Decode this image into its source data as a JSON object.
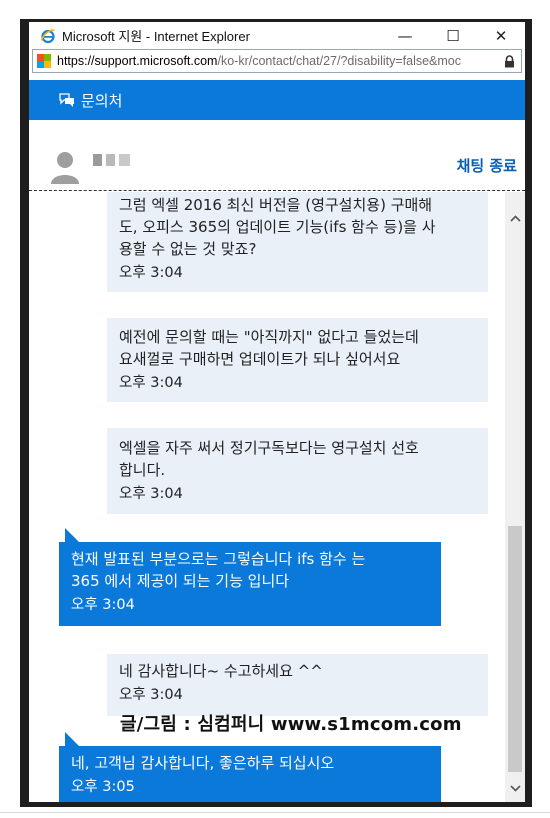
{
  "window": {
    "title": "Microsoft 지원 - Internet Explorer",
    "controls": {
      "minimize": "—",
      "maximize": "☐",
      "close": "✕"
    }
  },
  "address": {
    "url_domain": "https://support.microsoft.com",
    "url_rest": "/ko-kr/contact/chat/27/?disability=false&moc"
  },
  "header": {
    "title": "문의처"
  },
  "agent": {
    "end_chat": "채팅 종료"
  },
  "messages": [
    {
      "role": "user",
      "lines": [
        "그럼 엑셀 2016 최신 버전을 (영구설치용) 구매해",
        "도, 오피스 365의 업데이트 기능(ifs 함수 등)을 사",
        "용할 수 없는 것 맞죠?"
      ],
      "time": "오후 3:04"
    },
    {
      "role": "user",
      "lines": [
        "예전에 문의할 때는 \"아직까지\" 없다고 들었는데",
        "요새껄로 구매하면 업데이트가 되나 싶어서요"
      ],
      "time": "오후 3:04"
    },
    {
      "role": "user",
      "lines": [
        "엑셀을 자주 써서 정기구독보다는 영구설치 선호",
        "합니다."
      ],
      "time": "오후 3:04"
    },
    {
      "role": "agent",
      "lines": [
        "현재 발표된 부분으로는 그렇습니다 ifs 함수 는",
        "365 에서 제공이 되는 기능 입니다"
      ],
      "time": "오후 3:04"
    },
    {
      "role": "user",
      "lines": [
        "네 감사합니다~ 수고하세요 ^^"
      ],
      "time": "오후 3:04"
    },
    {
      "role": "agent",
      "lines": [
        "네, 고객님 감사합니다, 좋은하루 되십시오"
      ],
      "time": "오후 3:05"
    }
  ],
  "watermark": "글/그림 : 심컴퍼니 www.s1mcom.com",
  "colors": {
    "accent": "#0a79d9",
    "user_bubble": "#e9f0f8",
    "end_chat": "#0a5fb0"
  }
}
